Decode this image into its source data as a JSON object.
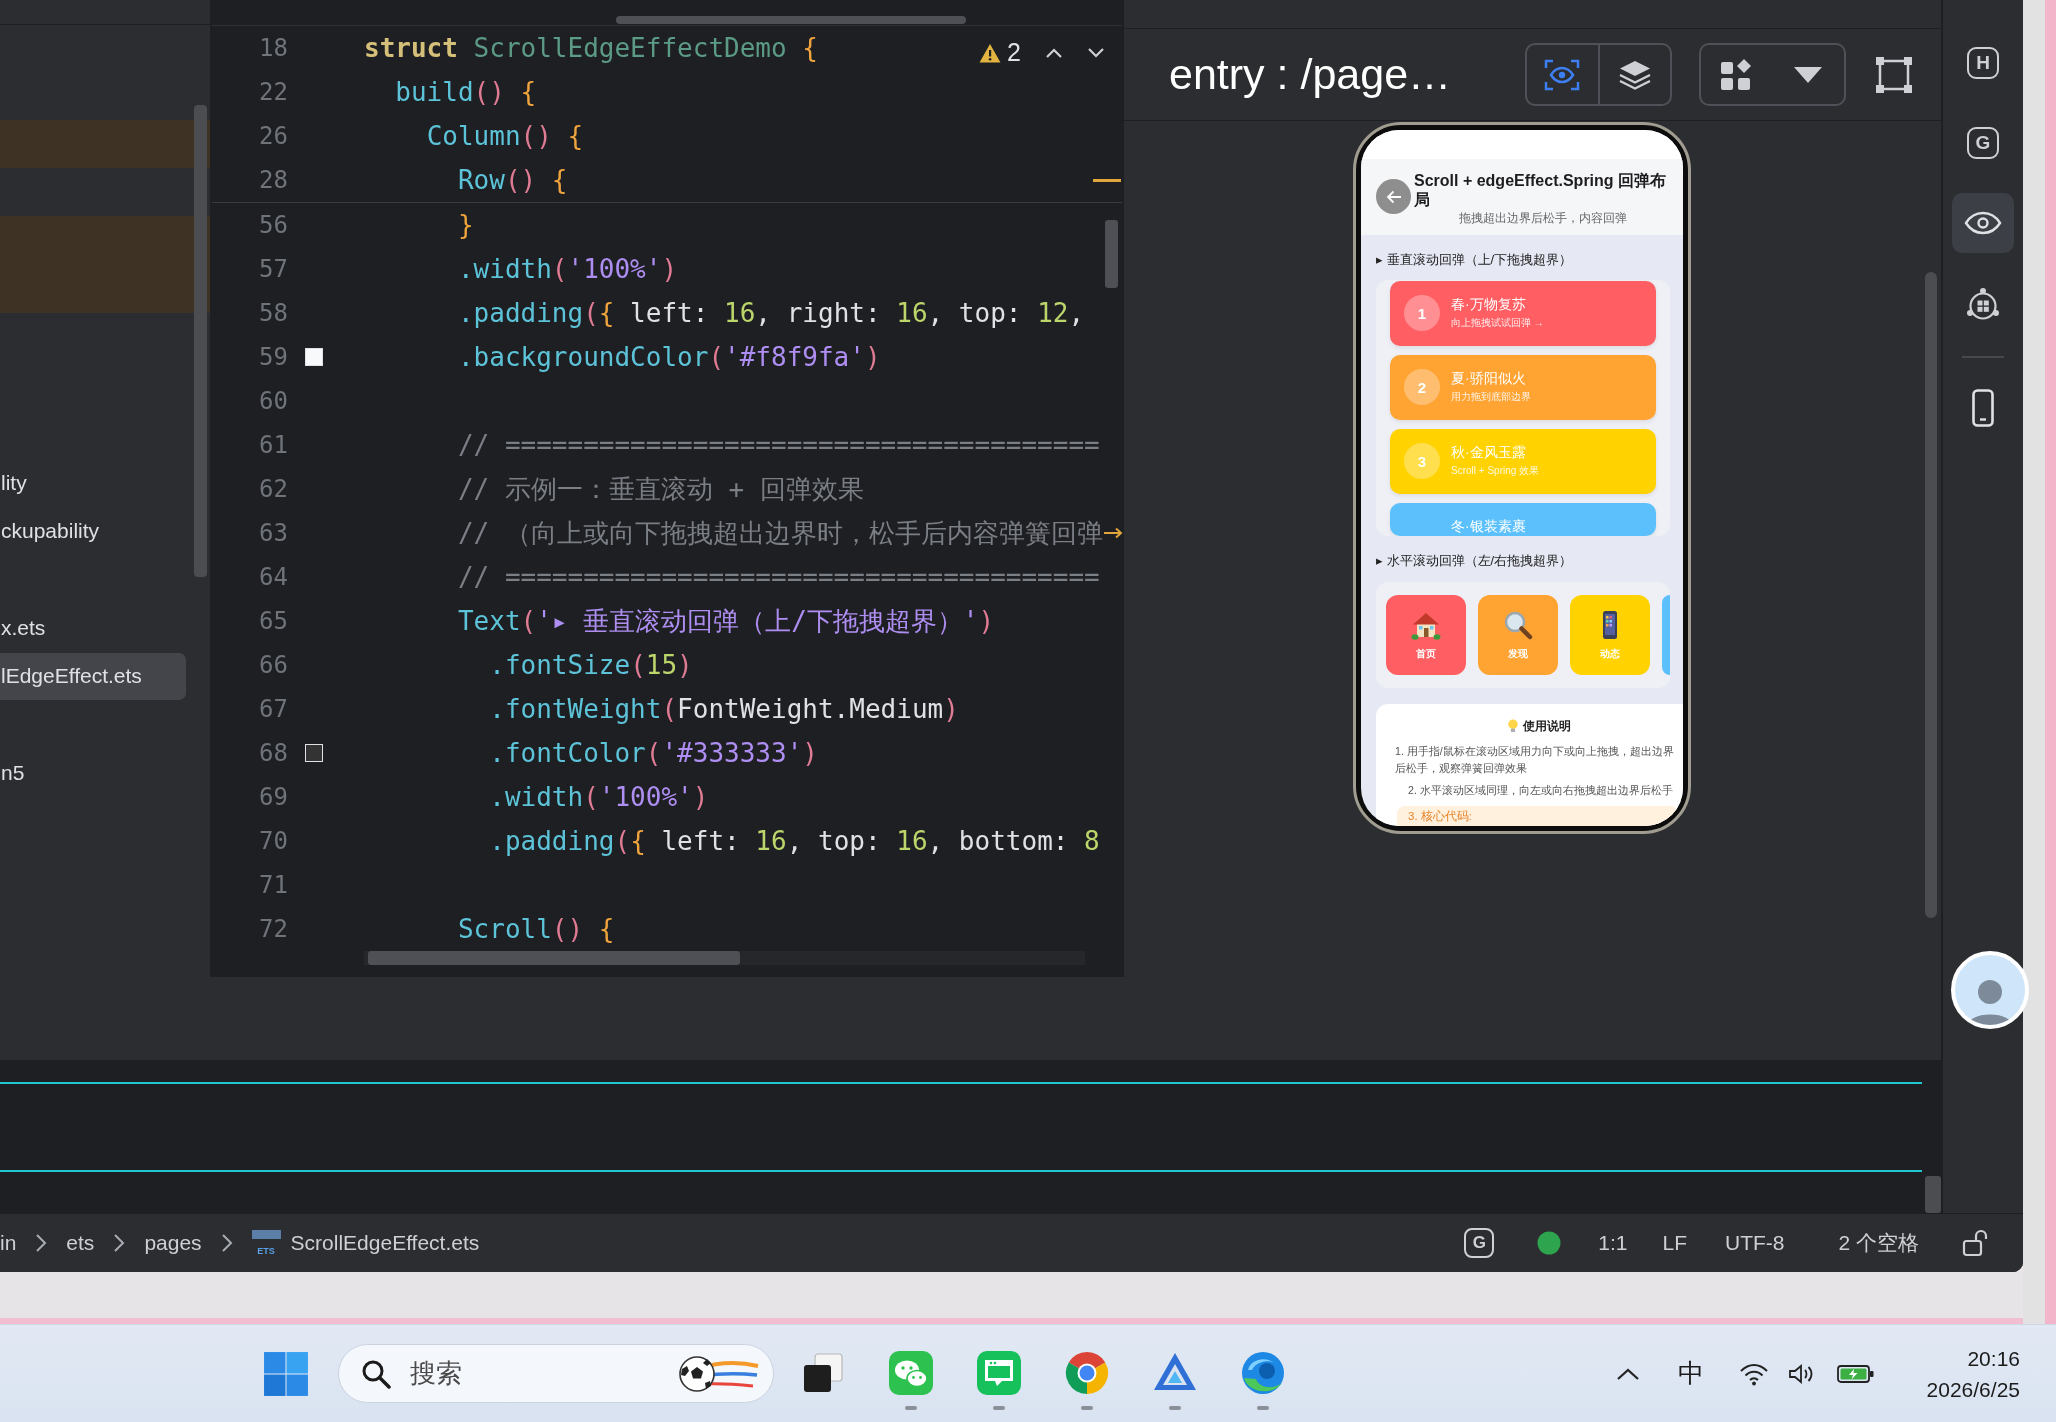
{
  "sidebar": {
    "rows": [
      {
        "highlighted": true,
        "selected": false
      },
      {
        "highlighted": true,
        "selected": false
      },
      {
        "highlighted": true,
        "selected": false
      },
      {
        "label": "lity",
        "highlighted": false,
        "selected": false
      },
      {
        "label": "ckupability",
        "highlighted": false,
        "selected": false
      },
      {
        "label": "x.ets",
        "highlighted": false,
        "selected": false
      },
      {
        "label": "lEdgeEffect.ets",
        "highlighted": false,
        "selected": true
      },
      {
        "label": "n5",
        "highlighted": false,
        "selected": false
      }
    ]
  },
  "editor": {
    "warning_count": "2",
    "sticky_lines": [
      {
        "number": "18",
        "marked": false,
        "tokens": [
          {
            "text": "struct ",
            "kind": "keyword"
          },
          {
            "text": "ScrollEdgeEffectDemo ",
            "kind": "type"
          },
          {
            "text": "{",
            "kind": "brace"
          }
        ]
      },
      {
        "number": "22",
        "marked": false,
        "tokens": [
          {
            "text": "  build",
            "kind": "call"
          },
          {
            "text": "()",
            "kind": "paren"
          },
          {
            "text": " {",
            "kind": "brace"
          }
        ]
      },
      {
        "number": "26",
        "marked": false,
        "tokens": [
          {
            "text": "    Column",
            "kind": "call"
          },
          {
            "text": "()",
            "kind": "paren"
          },
          {
            "text": " {",
            "kind": "brace"
          }
        ]
      },
      {
        "number": "28",
        "marked": true,
        "tokens": [
          {
            "text": "      Row",
            "kind": "call"
          },
          {
            "text": "()",
            "kind": "paren"
          },
          {
            "text": " {",
            "kind": "brace"
          }
        ]
      }
    ],
    "lines": [
      {
        "number": "56",
        "marked": false,
        "tokens": [
          {
            "text": "      }",
            "kind": "brace"
          }
        ]
      },
      {
        "number": "57",
        "marked": false,
        "tokens": [
          {
            "text": "      .width",
            "kind": "call"
          },
          {
            "text": "(",
            "kind": "paren"
          },
          {
            "text": "'100%'",
            "kind": "string"
          },
          {
            "text": ")",
            "kind": "paren"
          }
        ]
      },
      {
        "number": "58",
        "marked": false,
        "tokens": [
          {
            "text": "      .padding",
            "kind": "call"
          },
          {
            "text": "(",
            "kind": "paren"
          },
          {
            "text": "{",
            "kind": "brace"
          },
          {
            "text": " left: ",
            "kind": "plain"
          },
          {
            "text": "16",
            "kind": "number"
          },
          {
            "text": ", right: ",
            "kind": "plain"
          },
          {
            "text": "16",
            "kind": "number"
          },
          {
            "text": ", top: ",
            "kind": "plain"
          },
          {
            "text": "12",
            "kind": "number"
          },
          {
            "text": ",",
            "kind": "plain"
          }
        ]
      },
      {
        "number": "59",
        "marked": false,
        "tokens": [
          {
            "text": "      .backgroundColor",
            "kind": "call"
          },
          {
            "text": "(",
            "kind": "paren"
          },
          {
            "text": "'#f8f9fa'",
            "kind": "string"
          },
          {
            "text": ")",
            "kind": "paren"
          }
        ],
        "color": "#f8f9fa"
      },
      {
        "number": "60",
        "marked": false
      },
      {
        "number": "61",
        "marked": false,
        "tokens": [
          {
            "text": "      // ======================================",
            "kind": "comment"
          }
        ]
      },
      {
        "number": "62",
        "marked": false,
        "tokens": [
          {
            "text": "      // 示例一：垂直滚动 + 回弹效果",
            "kind": "comment"
          }
        ]
      },
      {
        "number": "63",
        "marked": true,
        "tokens": [
          {
            "text": "      // （向上或向下拖拽超出边界时，松手后内容弹簧回弹",
            "kind": "comment"
          }
        ]
      },
      {
        "number": "64",
        "marked": false,
        "tokens": [
          {
            "text": "      // ======================================",
            "kind": "comment"
          }
        ]
      },
      {
        "number": "65",
        "marked": false,
        "tokens": [
          {
            "text": "      Text",
            "kind": "call"
          },
          {
            "text": "(",
            "kind": "paren"
          },
          {
            "text": "'▸ 垂直滚动回弹（上/下拖拽超界）'",
            "kind": "string"
          },
          {
            "text": ")",
            "kind": "paren"
          }
        ]
      },
      {
        "number": "66",
        "marked": false,
        "tokens": [
          {
            "text": "        .fontSize",
            "kind": "call"
          },
          {
            "text": "(",
            "kind": "paren"
          },
          {
            "text": "15",
            "kind": "number"
          },
          {
            "text": ")",
            "kind": "paren"
          }
        ]
      },
      {
        "number": "67",
        "marked": false,
        "tokens": [
          {
            "text": "        .fontWeight",
            "kind": "call"
          },
          {
            "text": "(",
            "kind": "paren"
          },
          {
            "text": "FontWeight.Medium",
            "kind": "plain"
          },
          {
            "text": ")",
            "kind": "paren"
          }
        ]
      },
      {
        "number": "68",
        "marked": false,
        "tokens": [
          {
            "text": "        .fontColor",
            "kind": "call"
          },
          {
            "text": "(",
            "kind": "paren"
          },
          {
            "text": "'#333333'",
            "kind": "string"
          },
          {
            "text": ")",
            "kind": "paren"
          }
        ],
        "color": "#333333"
      },
      {
        "number": "69",
        "marked": false,
        "tokens": [
          {
            "text": "        .width",
            "kind": "call"
          },
          {
            "text": "(",
            "kind": "paren"
          },
          {
            "text": "'100%'",
            "kind": "string"
          },
          {
            "text": ")",
            "kind": "paren"
          }
        ]
      },
      {
        "number": "70",
        "marked": false,
        "tokens": [
          {
            "text": "        .padding",
            "kind": "call"
          },
          {
            "text": "(",
            "kind": "paren"
          },
          {
            "text": "{",
            "kind": "brace"
          },
          {
            "text": " left: ",
            "kind": "plain"
          },
          {
            "text": "16",
            "kind": "number"
          },
          {
            "text": ", top: ",
            "kind": "plain"
          },
          {
            "text": "16",
            "kind": "number"
          },
          {
            "text": ", bottom: ",
            "kind": "plain"
          },
          {
            "text": "8",
            "kind": "number"
          }
        ]
      },
      {
        "number": "71",
        "marked": false
      },
      {
        "number": "72",
        "marked": false,
        "tokens": [
          {
            "text": "      Scroll",
            "kind": "call"
          },
          {
            "text": "()",
            "kind": "paren"
          },
          {
            "text": " {",
            "kind": "brace"
          }
        ]
      }
    ]
  },
  "preview": {
    "title": "entry : /page…",
    "tools": [
      {
        "selected": true
      },
      {
        "selected": false
      }
    ],
    "phone": {
      "header": {
        "title": "Scroll + edgeEffect.Spring 回弹布局",
        "subtitle": "拖拽超出边界后松手，内容回弹"
      },
      "sections": [
        {
          "kind": "vertical",
          "title": "▸ 垂直滚动回弹（上/下拖拽超界）",
          "cards": [
            {
              "number": "1",
              "title": "春·万物复苏",
              "subtitle": "向上拖拽试试回弹 →",
              "color": "#ff5f63"
            },
            {
              "number": "2",
              "title": "夏·骄阳似火",
              "subtitle": "用力拖到底部边界",
              "color": "#ffa332"
            },
            {
              "number": "3",
              "title": "秋·金风玉露",
              "subtitle": "Scroll + Spring 效果",
              "color": "#ffd200"
            },
            {
              "title": "冬·银装素裹",
              "color": "#5bc0fb"
            }
          ]
        },
        {
          "kind": "horizontal",
          "title": "▸ 水平滚动回弹（左/右拖拽超界）",
          "tiles": [
            {
              "label": "首页",
              "color": "#ff5f63"
            },
            {
              "label": "发现",
              "color": "#ffa332"
            },
            {
              "label": "动态",
              "color": "#ffd200"
            },
            {
              "color": "#5bc0fb"
            }
          ]
        }
      ],
      "notes": {
        "title": "使用说明",
        "items": [
          "1. 用手指/鼠标在滚动区域用力向下或向上拖拽，超出边界后松手，观察弹簧回弹效果",
          "2. 水平滚动区域同理，向左或向右拖拽超出边界后松手"
        ],
        "code_label": "3. 核心代码:"
      }
    }
  },
  "toolbar": {
    "items": [
      {
        "glyph": "H",
        "selected": false
      },
      {
        "glyph": "G",
        "selected": false
      },
      {
        "selected": true
      },
      {
        "selected": false
      },
      {
        "selected": false
      }
    ]
  },
  "status_bar": {
    "breadcrumb": [
      {
        "label": "in"
      },
      {
        "label": "ets"
      },
      {
        "label": "pages"
      },
      {
        "label": "ScrollEdgeEffect.ets",
        "badge": "ETS"
      }
    ],
    "badge": "G",
    "position": "1:1",
    "line_ending": "LF",
    "encoding": "UTF-8",
    "indent": "2 个空格",
    "locked": false
  },
  "taskbar": {
    "search": {
      "placeholder": "搜索"
    },
    "apps": [
      {
        "running": false
      },
      {
        "running": true
      },
      {
        "running": true
      },
      {
        "running": true
      },
      {
        "running": true
      },
      {
        "running": true
      }
    ],
    "ime": "中",
    "time": "20:16",
    "date": "2026/6/25"
  }
}
